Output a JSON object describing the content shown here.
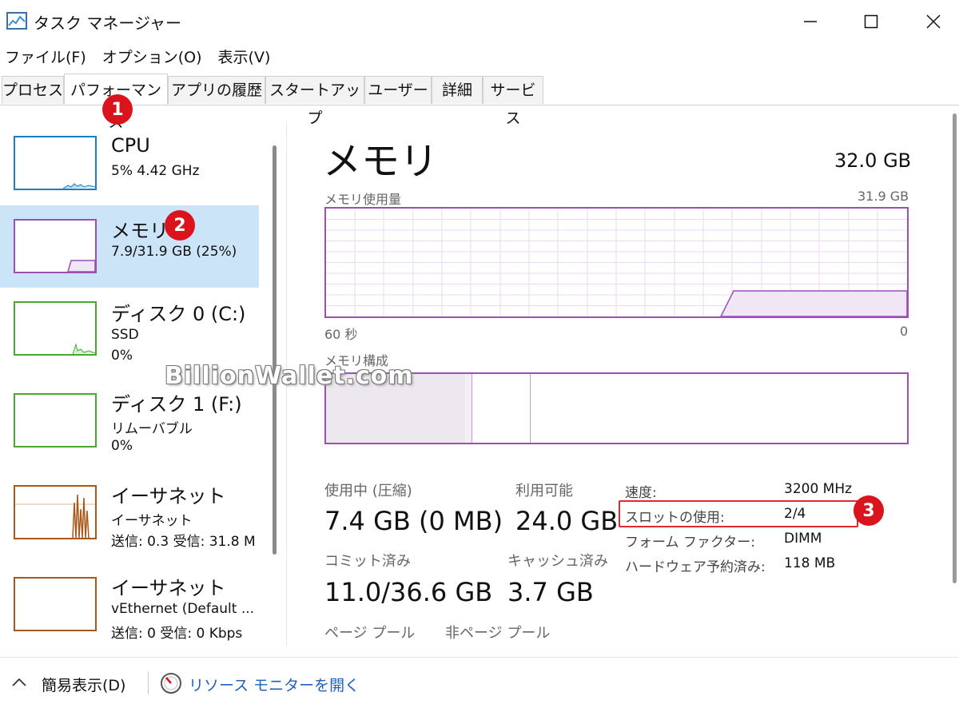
{
  "window": {
    "title": "タスク マネージャー",
    "icon": "task-manager-graph-icon"
  },
  "menu": [
    {
      "label": "ファイル(F)"
    },
    {
      "label": "オプション(O)"
    },
    {
      "label": "表示(V)"
    }
  ],
  "tabs": [
    {
      "label": "プロセス"
    },
    {
      "label": "パフォーマンス"
    },
    {
      "label": "アプリの履歴"
    },
    {
      "label": "スタートアップ"
    },
    {
      "label": "ユーザー"
    },
    {
      "label": "詳細"
    },
    {
      "label": "サービス"
    }
  ],
  "active_tab": "パフォーマンス",
  "badges": {
    "one": "1",
    "two": "2",
    "three": "3"
  },
  "sidebar": {
    "items": [
      {
        "name": "CPU",
        "line1": "5%  4.42 GHz",
        "line2": "",
        "color": "#1b7fc5"
      },
      {
        "name": "メモリ",
        "line1": "7.9/31.9 GB (25%)",
        "line2": "",
        "color": "#9b4fb5"
      },
      {
        "name": "ディスク 0 (C:)",
        "line1": "SSD",
        "line2": "0%",
        "color": "#4aa832"
      },
      {
        "name": "ディスク 1 (F:)",
        "line1": "リムーバブル",
        "line2": "0%",
        "color": "#4aa832"
      },
      {
        "name": "イーサネット",
        "line1": "イーサネット",
        "line2": "送信: 0.3 受信: 31.8 M",
        "color": "#a7581a"
      },
      {
        "name": "イーサネット",
        "line1": "vEthernet (Default ...",
        "line2": "送信: 0 受信: 0 Kbps",
        "color": "#a7581a"
      }
    ]
  },
  "main": {
    "title": "メモリ",
    "total": "32.0 GB",
    "usage_label": "メモリ使用量",
    "usage_max": "31.9 GB",
    "axis_left": "60 秒",
    "axis_right": "0",
    "composition_label": "メモリ構成",
    "stats": {
      "in_use_label": "使用中 (圧縮)",
      "in_use_value": "7.4 GB (0 MB)",
      "available_label": "利用可能",
      "available_value": "24.0 GB",
      "committed_label": "コミット済み",
      "committed_value": "11.0/36.6 GB",
      "cached_label": "キャッシュ済み",
      "cached_value": "3.7 GB",
      "paged_pool_label": "ページ プール",
      "nonpaged_pool_label": "非ページ プール"
    },
    "specs": [
      {
        "label": "速度:",
        "value": "3200 MHz"
      },
      {
        "label": "スロットの使用:",
        "value": "2/4"
      },
      {
        "label": "フォーム ファクター:",
        "value": "DIMM"
      },
      {
        "label": "ハードウェア予約済み:",
        "value": "118 MB"
      }
    ]
  },
  "watermark": "BillionWallet.com",
  "footer": {
    "fewer_details": "簡易表示(D)",
    "resource_monitor": "リソース モニターを開く"
  },
  "colors": {
    "memory": "#9b4fb5",
    "badge": "#d9141c",
    "link": "#1f5fbf",
    "selected": "#cce4f7"
  }
}
